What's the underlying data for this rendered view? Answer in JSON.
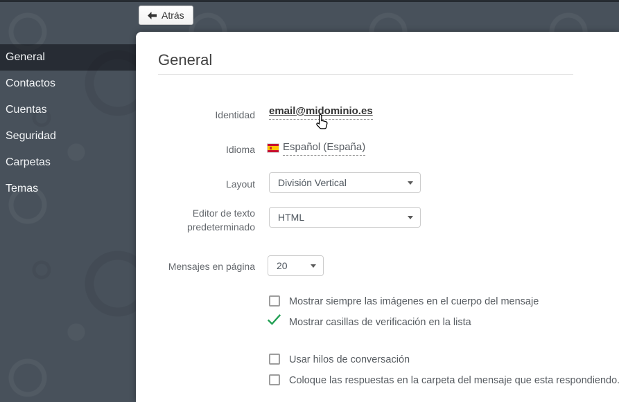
{
  "toolbar": {
    "back_label": "Atrás"
  },
  "sidebar": {
    "items": [
      {
        "label": "General",
        "active": true
      },
      {
        "label": "Contactos",
        "active": false
      },
      {
        "label": "Cuentas",
        "active": false
      },
      {
        "label": "Seguridad",
        "active": false
      },
      {
        "label": "Carpetas",
        "active": false
      },
      {
        "label": "Temas",
        "active": false
      }
    ]
  },
  "main": {
    "title": "General",
    "fields": {
      "identity": {
        "label": "Identidad",
        "value": "email@midominio.es"
      },
      "language": {
        "label": "Idioma",
        "value": "Español (España)",
        "flag": "spain-flag-icon"
      },
      "layout": {
        "label": "Layout",
        "value": "División Vertical"
      },
      "editor": {
        "label_line1": "Editor de texto",
        "label_line2": "predeterminado",
        "value": "HTML"
      },
      "messages_per_page": {
        "label": "Mensajes en página",
        "value": "20"
      }
    },
    "checkboxes": [
      {
        "label": "Mostrar siempre las imágenes en el cuerpo del mensaje",
        "checked": false
      },
      {
        "label": "Mostrar casillas de verificación en la lista",
        "checked": true
      },
      {
        "label": "Usar hilos de conversación",
        "checked": false
      },
      {
        "label": "Coloque las respuestas en la carpeta del mensaje que esta respondiendo.",
        "checked": false
      }
    ]
  },
  "colors": {
    "background": "#48515b",
    "active_item_bg": "rgba(12,15,20,0.55)",
    "check_green": "#22a054",
    "flag_red": "#c8102e",
    "flag_yellow": "#ffc400"
  }
}
